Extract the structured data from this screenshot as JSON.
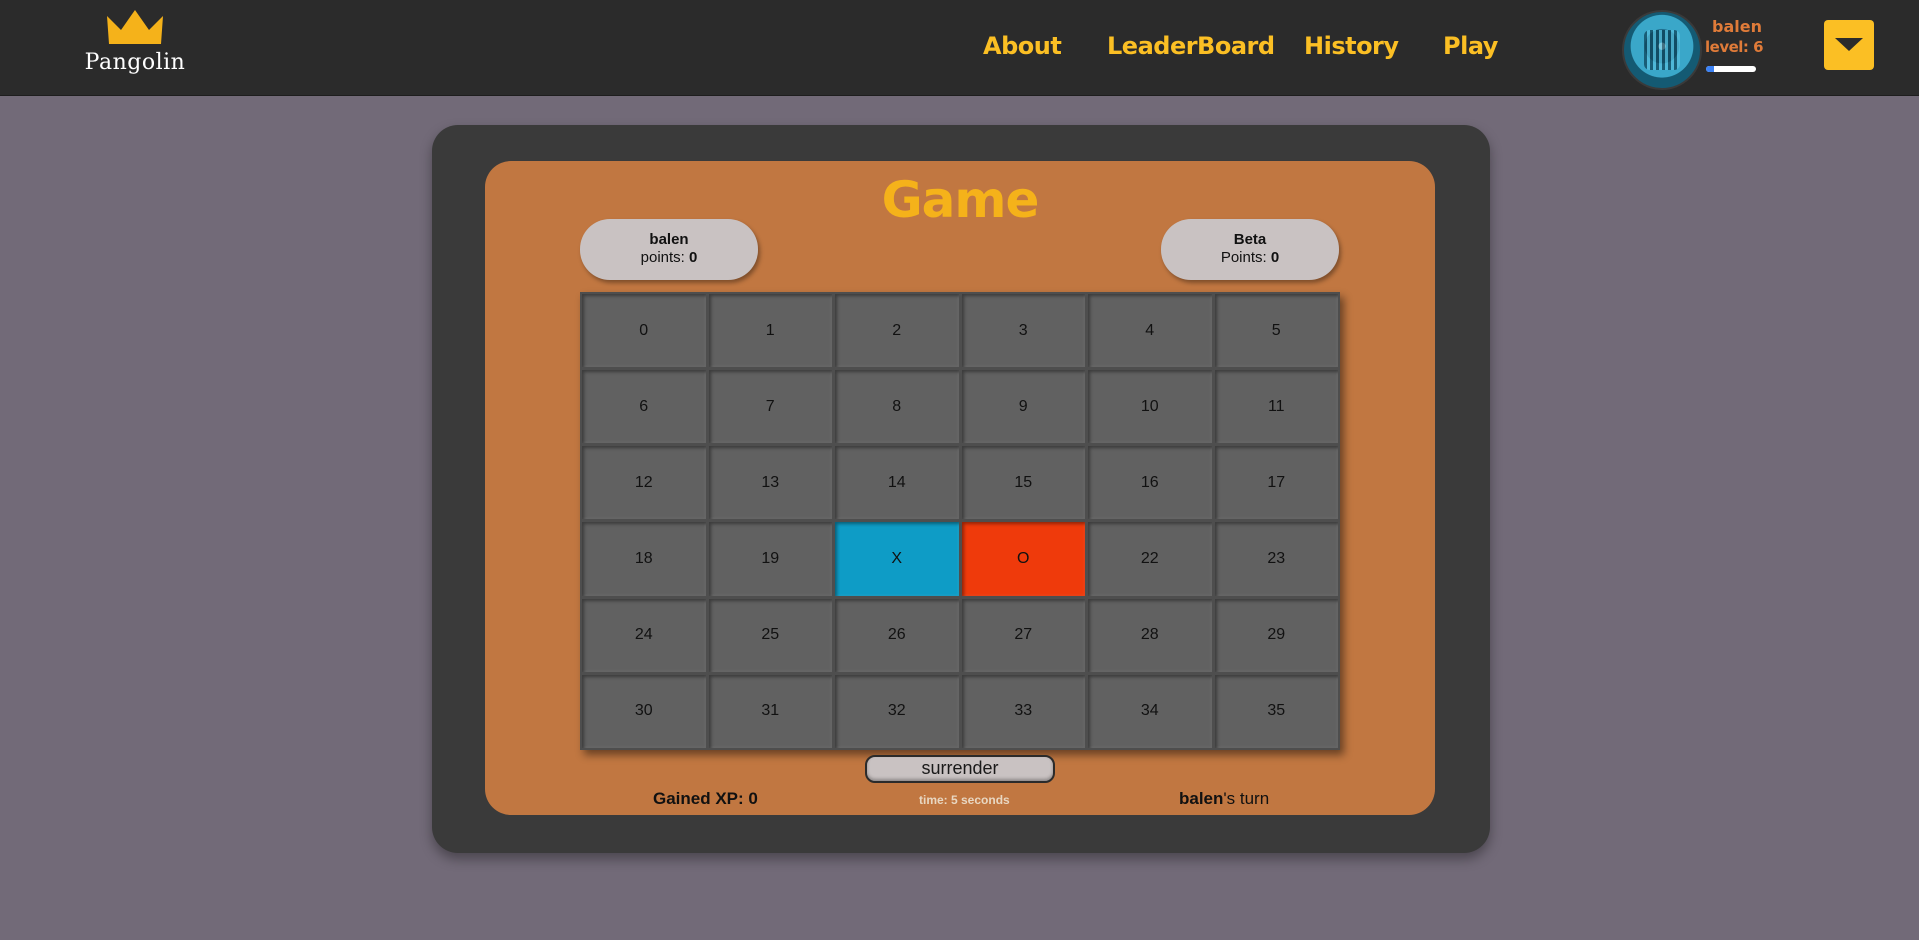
{
  "app": {
    "logo_text": "Pangolin"
  },
  "nav": {
    "items": [
      "About",
      "LeaderBoard",
      "History",
      "Play"
    ]
  },
  "user": {
    "name": "balen",
    "level_label": "level: 6",
    "xp_progress": 0.15
  },
  "game": {
    "title": "Game",
    "player1": {
      "name": "balen",
      "points_label": "points: ",
      "points": "0"
    },
    "player2": {
      "name": "Beta",
      "points_label": "Points: ",
      "points": "0"
    },
    "cells": [
      "0",
      "1",
      "2",
      "3",
      "4",
      "5",
      "6",
      "7",
      "8",
      "9",
      "10",
      "11",
      "12",
      "13",
      "14",
      "15",
      "16",
      "17",
      "18",
      "19",
      "X",
      "O",
      "22",
      "23",
      "24",
      "25",
      "26",
      "27",
      "28",
      "29",
      "30",
      "31",
      "32",
      "33",
      "34",
      "35"
    ],
    "surrender_label": "surrender",
    "gained_xp": "Gained XP: 0",
    "time": "time: 5 seconds",
    "turn_player": "balen",
    "turn_suffix": "'s turn"
  },
  "colors": {
    "header_bg": "#2b2b2b",
    "accent": "#fbbf24",
    "page_bg": "#726a78",
    "panel_bg": "#c17741",
    "x_cell": "#0e9cc6",
    "o_cell": "#ef3a0b"
  },
  "icons": {
    "logo": "crown-icon",
    "dropdown": "caret-down-icon"
  }
}
